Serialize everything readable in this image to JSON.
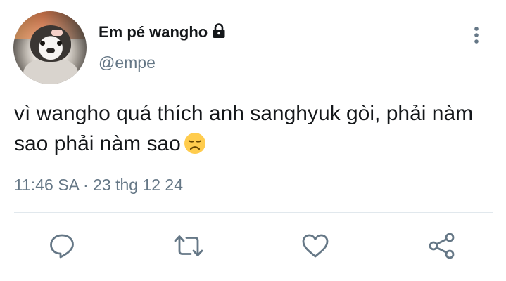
{
  "user": {
    "display_name": "Em pé wangho",
    "handle": "@empe",
    "avatar_icon": "penguin-avatar",
    "protected_icon": "lock-icon"
  },
  "tweet": {
    "text": "vì wangho quá thích anh sanghyuk gòi, phải nàm sao phải nàm sao",
    "emoji": "disappointed-face-emoji",
    "timestamp": "11:46 SA · 23 thg 12 24"
  },
  "actions": [
    {
      "name": "reply",
      "icon": "reply-icon"
    },
    {
      "name": "retweet",
      "icon": "retweet-icon"
    },
    {
      "name": "like",
      "icon": "heart-icon"
    },
    {
      "name": "share",
      "icon": "share-icon"
    }
  ],
  "colors": {
    "text": "#14171a",
    "secondary": "#657786",
    "divider": "#e1e8ed",
    "action_icon": "#657786"
  }
}
